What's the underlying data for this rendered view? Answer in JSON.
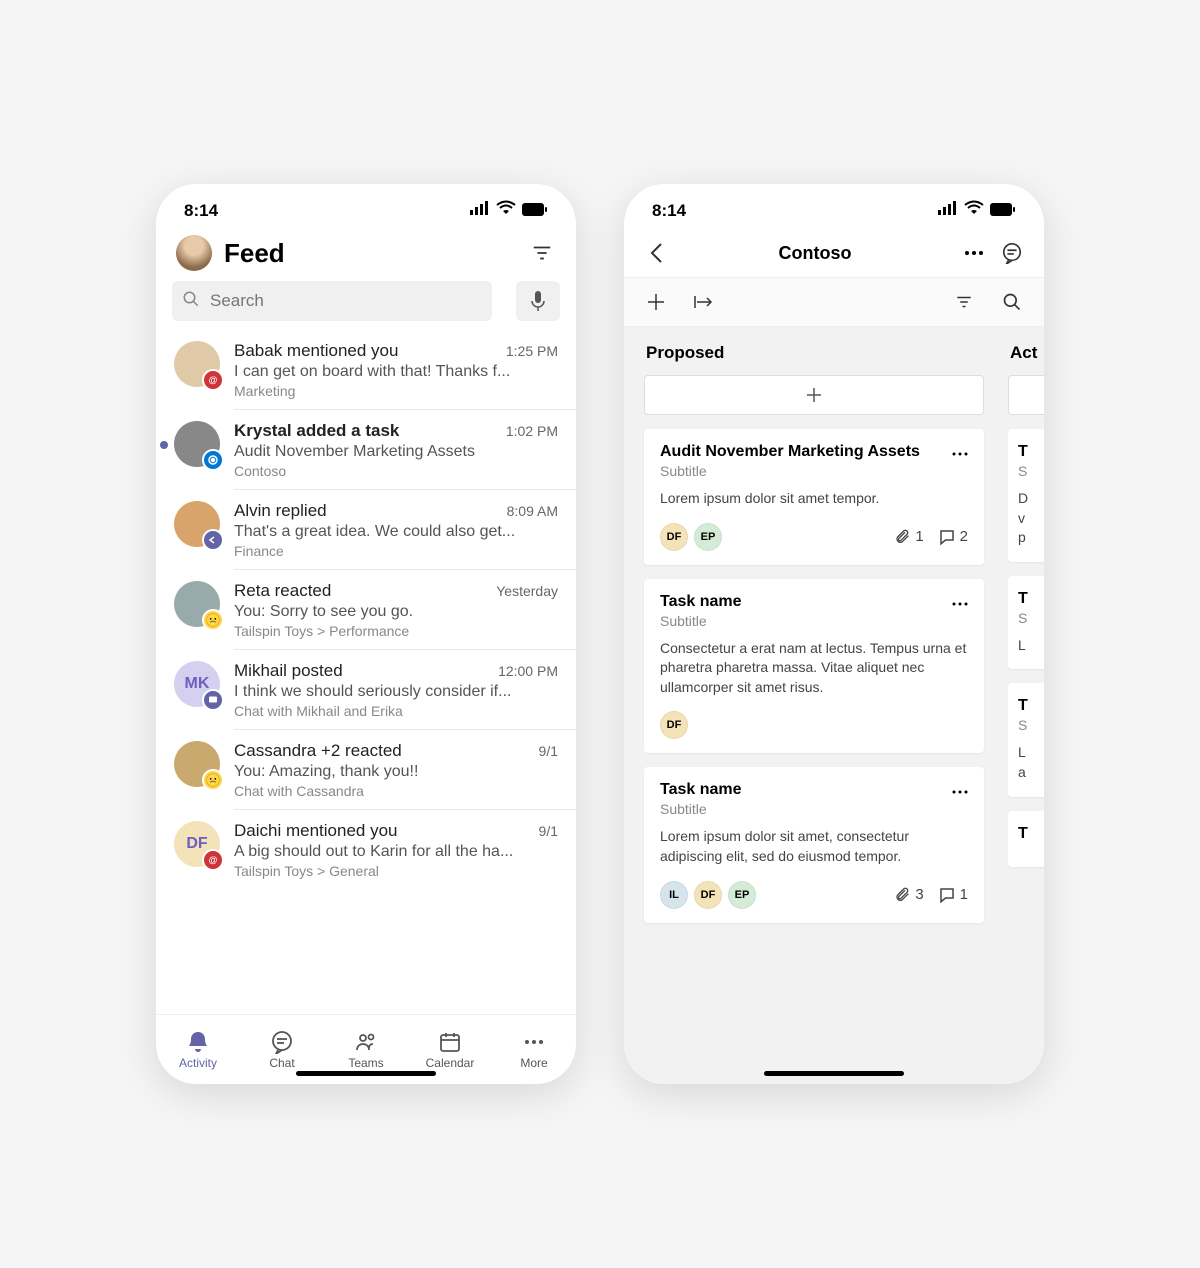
{
  "status": {
    "time": "8:14"
  },
  "feed": {
    "title": "Feed",
    "search_placeholder": "Search",
    "items": [
      {
        "title": "Babak mentioned you",
        "time": "1:25 PM",
        "preview": "I can get on board with that! Thanks f...",
        "context": "Marketing",
        "badge": "mention",
        "badgeColor": "#d13438",
        "avColor": "#e0c9a6"
      },
      {
        "title": "Krystal added a task",
        "time": "1:02 PM",
        "preview": "Audit November Marketing Assets",
        "context": "Contoso",
        "badge": "task",
        "badgeColor": "#0078d4",
        "avColor": "#888",
        "unread": true
      },
      {
        "title": "Alvin replied",
        "time": "8:09 AM",
        "preview": "That's a great idea. We could also get...",
        "context": "Finance",
        "badge": "reply",
        "badgeColor": "#6264a7",
        "avColor": "#d9a36c"
      },
      {
        "title": "Reta reacted",
        "time": "Yesterday",
        "preview": "You: Sorry to see you go.",
        "context": "Tailspin Toys > Performance",
        "badge": "react",
        "badgeColor": "#ffd54a",
        "avColor": "#9aa"
      },
      {
        "title": "Mikhail posted",
        "time": "12:00 PM",
        "preview": "I think we should seriously consider if...",
        "context": "Chat with Mikhail and Erika",
        "badge": "post",
        "badgeColor": "#6264a7",
        "avColor": "#d6d0f0",
        "initials": "MK"
      },
      {
        "title": "Cassandra +2 reacted",
        "time": "9/1",
        "preview": "You: Amazing, thank you!!",
        "context": "Chat with Cassandra",
        "badge": "react",
        "badgeColor": "#ffd54a",
        "avColor": "#c9a96e"
      },
      {
        "title": "Daichi mentioned you",
        "time": "9/1",
        "preview": "A big should out to Karin for all the ha...",
        "context": "Tailspin Toys > General",
        "badge": "mention",
        "badgeColor": "#d13438",
        "avColor": "#f4e2b8",
        "initials": "DF"
      }
    ],
    "tabs": [
      {
        "label": "Activity"
      },
      {
        "label": "Chat"
      },
      {
        "label": "Teams"
      },
      {
        "label": "Calendar"
      },
      {
        "label": "More"
      }
    ]
  },
  "board": {
    "title": "Contoso",
    "columns": [
      {
        "name": "Proposed"
      },
      {
        "name": "Act"
      }
    ],
    "cards": [
      {
        "title": "Audit November Marketing Assets",
        "subtitle": "Subtitle",
        "desc": "Lorem ipsum dolor sit amet tempor.",
        "assignees": [
          {
            "i": "DF",
            "c": "#f4e2b8"
          },
          {
            "i": "EP",
            "c": "#d4ecd5"
          }
        ],
        "attachments": "1",
        "comments": "2"
      },
      {
        "title": "Task name",
        "subtitle": "Subtitle",
        "desc": "Consectetur a erat nam at lectus. Tempus urna et pharetra pharetra massa. Vitae aliquet nec ullamcorper sit amet risus.",
        "assignees": [
          {
            "i": "DF",
            "c": "#f4e2b8"
          }
        ]
      },
      {
        "title": "Task name",
        "subtitle": "Subtitle",
        "desc": "Lorem ipsum dolor sit amet, consectetur adipiscing elit, sed do eiusmod tempor.",
        "assignees": [
          {
            "i": "IL",
            "c": "#d6e4ec"
          },
          {
            "i": "DF",
            "c": "#f4e2b8"
          },
          {
            "i": "EP",
            "c": "#d4ecd5"
          }
        ],
        "attachments": "3",
        "comments": "1"
      }
    ],
    "peek_cards": [
      {
        "title": "T",
        "subtitle": "S",
        "desc": "D\nv\np"
      },
      {
        "title": "T",
        "subtitle": "S",
        "desc": "L"
      },
      {
        "title": "T",
        "subtitle": "S",
        "desc": "L\na"
      },
      {
        "title": "T",
        "subtitle": "",
        "desc": ""
      }
    ]
  }
}
